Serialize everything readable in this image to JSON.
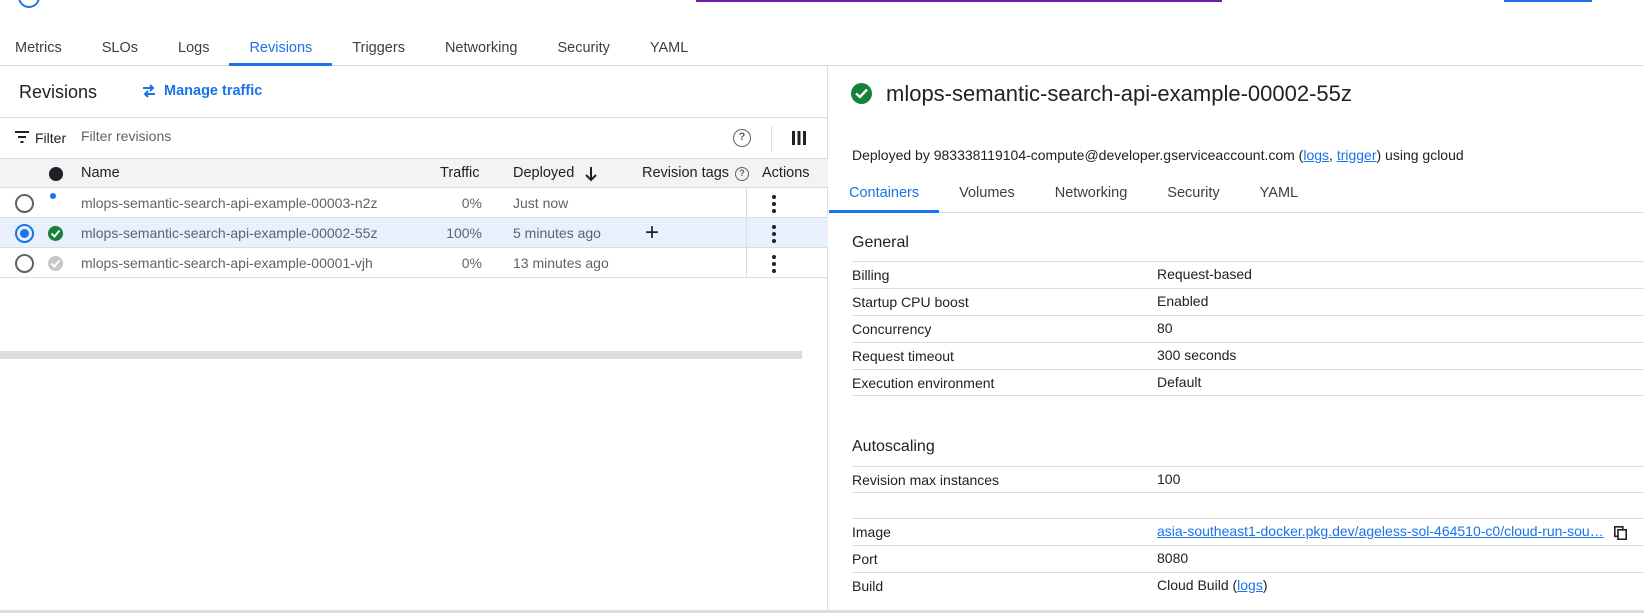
{
  "main_tabs": [
    "Metrics",
    "SLOs",
    "Logs",
    "Revisions",
    "Triggers",
    "Networking",
    "Security",
    "YAML"
  ],
  "revisions_panel": {
    "title": "Revisions",
    "manage_traffic_label": "Manage traffic",
    "filter_label": "Filter",
    "filter_placeholder": "Filter revisions",
    "columns": {
      "name": "Name",
      "traffic": "Traffic",
      "deployed": "Deployed",
      "revision_tags": "Revision tags",
      "actions": "Actions"
    },
    "rows": [
      {
        "name": "mlops-semantic-search-api-example-00003-n2z",
        "traffic": "0%",
        "deployed": "Just now",
        "status": "deploying",
        "selected": false
      },
      {
        "name": "mlops-semantic-search-api-example-00002-55z",
        "traffic": "100%",
        "deployed": "5 minutes ago",
        "status": "ok",
        "selected": true
      },
      {
        "name": "mlops-semantic-search-api-example-00001-vjh",
        "traffic": "0%",
        "deployed": "13 minutes ago",
        "status": "inactive",
        "selected": false
      }
    ]
  },
  "detail": {
    "title": "mlops-semantic-search-api-example-00002-55z",
    "deployed_by_prefix": "Deployed by 983338119104-compute@developer.gserviceaccount.com (",
    "logs_link": "logs",
    "comma": ", ",
    "trigger_link": "trigger",
    "deployed_by_suffix": ") using gcloud",
    "tabs": [
      "Containers",
      "Volumes",
      "Networking",
      "Security",
      "YAML"
    ],
    "general_title": "General",
    "general": [
      {
        "key": "Billing",
        "value": "Request-based"
      },
      {
        "key": "Startup CPU boost",
        "value": "Enabled"
      },
      {
        "key": "Concurrency",
        "value": "80"
      },
      {
        "key": "Request timeout",
        "value": "300 seconds"
      },
      {
        "key": "Execution environment",
        "value": "Default"
      }
    ],
    "autoscaling_title": "Autoscaling",
    "autoscaling": [
      {
        "key": "Revision max instances",
        "value": "100"
      }
    ],
    "container": {
      "image_key": "Image",
      "image_value": "asia-southeast1-docker.pkg.dev/ageless-sol-464510-c0/cloud-run-sou…",
      "port_key": "Port",
      "port_value": "8080",
      "build_key": "Build",
      "build_value_prefix": "Cloud Build (",
      "build_logs_link": "logs",
      "build_value_suffix": ")"
    }
  },
  "colors": {
    "accent": "#1a73e8",
    "ok": "#188038",
    "border": "#dadce0",
    "selected_row": "#e8f0fe"
  }
}
